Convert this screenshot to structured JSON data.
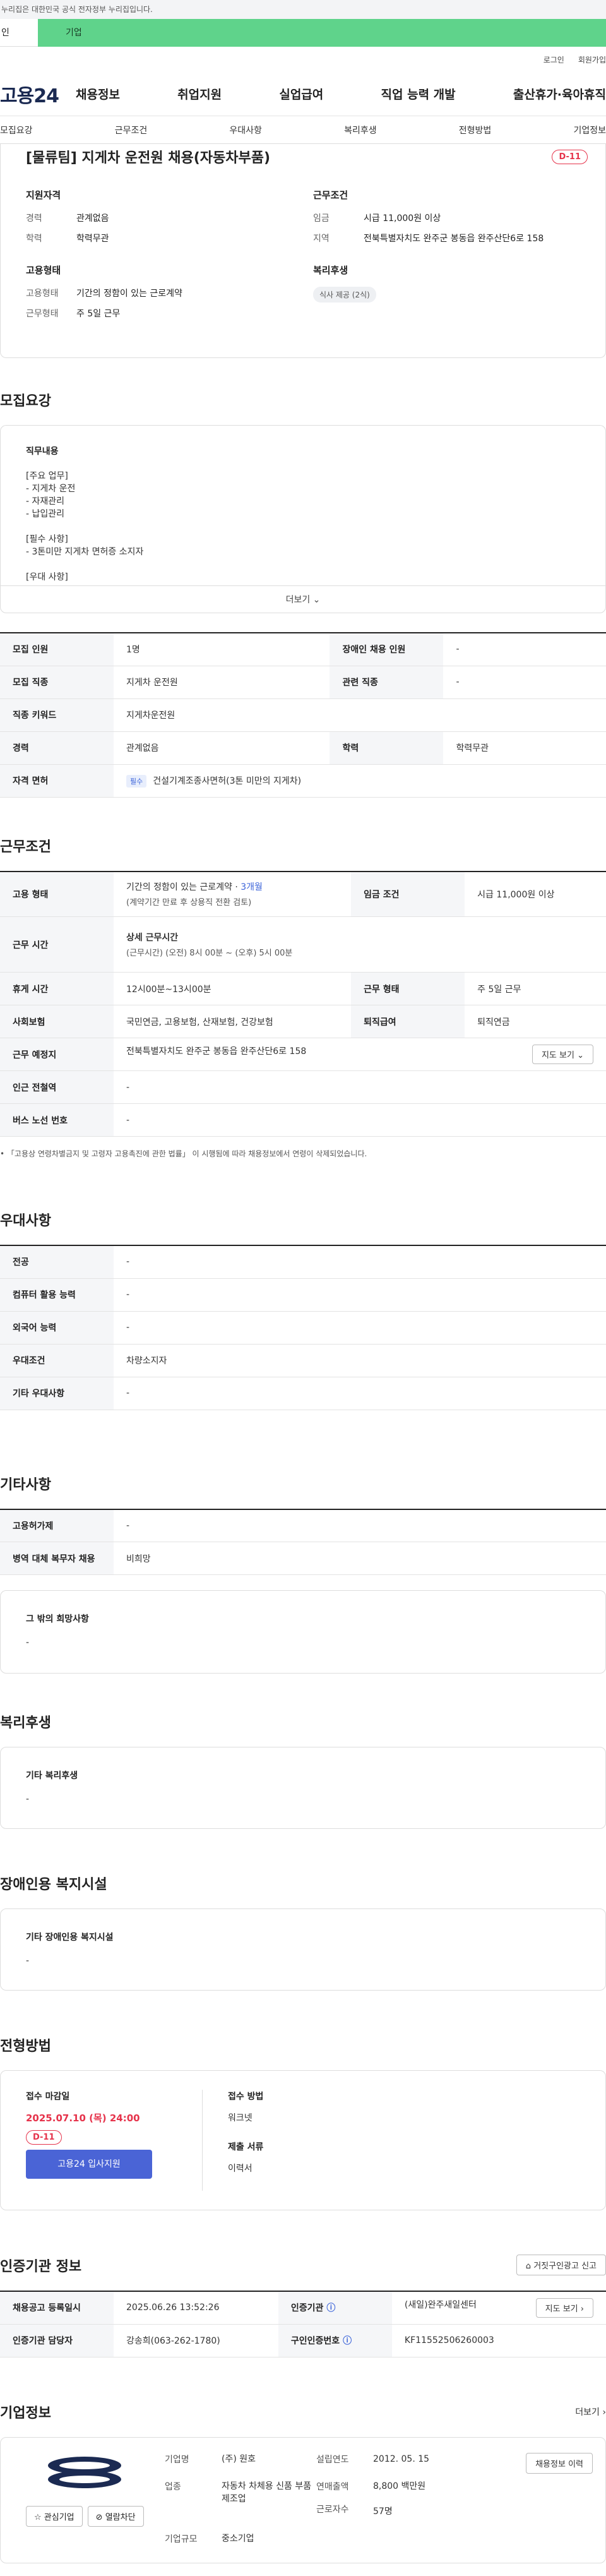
{
  "gov_banner": "누리집은 대한민국 공식 전자정부 누리집입니다.",
  "top_tabs": {
    "individual": "인",
    "company": "기업"
  },
  "util": {
    "login": "로그인",
    "signup": "회원가입"
  },
  "logo": "고용24",
  "gnb": [
    "채용정보",
    "취업지원",
    "실업급여",
    "직업 능력 개발",
    "출산휴가·육아휴직"
  ],
  "anchor_tabs": [
    "모집요강",
    "근무조건",
    "우대사항",
    "복리후생",
    "전형방법",
    "기업정보"
  ],
  "summary": {
    "title": "[물류팀] 지게차 운전원 채용(자동차부품)",
    "dday": "D-11",
    "qual": {
      "heading": "지원자격",
      "career_k": "경력",
      "career_v": "관계없음",
      "edu_k": "학력",
      "edu_v": "학력무관"
    },
    "cond": {
      "heading": "근무조건",
      "wage_k": "임금",
      "wage_v": "시급 11,000원 이상",
      "area_k": "지역",
      "area_v": "전북특별자치도 완주군 봉동읍 완주산단6로 158"
    },
    "emp": {
      "heading": "고용형태",
      "type_k": "고용형태",
      "type_v": "기간의 정함이 있는 근로계약",
      "shape_k": "근무형태",
      "shape_v": "주 5일 근무"
    },
    "welfare": {
      "heading": "복리후생",
      "chip": "식사 제공 (2식)"
    }
  },
  "recruit": {
    "section": "모집요강",
    "duty_heading": "직무내용",
    "lines_a": [
      "[주요 업무]",
      "- 지게차 운전",
      "- 자재관리",
      "- 납입관리"
    ],
    "lines_b": [
      "[필수 사항]",
      "- 3톤미만 지게차 면허증 소지자"
    ],
    "lines_c": [
      "[우대 사항]"
    ],
    "more": "더보기",
    "table": {
      "headcount_k": "모집 인원",
      "headcount_v": "1명",
      "disabled_k": "장애인 채용 인원",
      "disabled_v": "-",
      "job_k": "모집 직종",
      "job_v": "지게차 운전원",
      "related_k": "관련 직종",
      "related_v": "-",
      "keyword_k": "직종 키워드",
      "keyword_v": "지게차운전원",
      "career_k": "경력",
      "career_v": "관계없음",
      "edu_k": "학력",
      "edu_v": "학력무관",
      "license_k": "자격 면허",
      "license_tag": "필수",
      "license_v": "건설기계조종사면허(3톤 미만의 지게차)"
    }
  },
  "work": {
    "section": "근무조건",
    "emp_k": "고용 형태",
    "emp_v": "기간의 정함이 있는 근로계약 · ",
    "emp_v_blue": "3개월",
    "emp_sub": "(계약기간 만료 후 상용직 전환 검토)",
    "wage_k": "임금 조건",
    "wage_v": "시급 11,000원 이상",
    "hours_k": "근무 시간",
    "hours_title": "상세 근무시간",
    "hours_v": "(근무시간) (오전) 8시 00분 ~ (오후) 5시 00분",
    "break_k": "휴게 시간",
    "break_v": "12시00분~13시00분",
    "shape_k": "근무 형태",
    "shape_v": "주 5일 근무",
    "ins_k": "사회보험",
    "ins_v": "국민연금, 고용보험, 산재보험, 건강보험",
    "retire_k": "퇴직급여",
    "retire_v": "퇴직연금",
    "place_k": "근무 예정지",
    "place_v": "전북특별자치도 완주군 봉동읍 완주산단6로 158",
    "map_btn": "지도 보기",
    "station_k": "인근 전철역",
    "station_v": "-",
    "bus_k": "버스 노선 번호",
    "bus_v": "-",
    "note": "「고용상 연령차별금지 및 고령자 고용촉진에 관한 법률」 이 시행됨에 따라 채용정보에서 연령이 삭제되었습니다."
  },
  "pref": {
    "section": "우대사항",
    "major_k": "전공",
    "major_v": "-",
    "pc_k": "컴퓨터 활용 능력",
    "pc_v": "-",
    "lang_k": "외국어 능력",
    "lang_v": "-",
    "cond_k": "우대조건",
    "cond_v": "차량소지자",
    "etc_k": "기타 우대사항",
    "etc_v": "-"
  },
  "etc": {
    "section": "기타사항",
    "hire_k": "고용허가제",
    "hire_v": "-",
    "mil_k": "병역 대체 복무자 채용",
    "mil_v": "비희망",
    "wish_heading": "그 밖의 희망사항",
    "wish_v": "-"
  },
  "welfare": {
    "section": "복리후생",
    "heading": "기타 복리후생",
    "value": "-"
  },
  "disabled_fac": {
    "section": "장애인용 복지시설",
    "heading": "기타 장애인용 복지시설",
    "value": "-"
  },
  "process": {
    "section": "전형방법",
    "deadline_h": "접수 마감일",
    "deadline_v": "2025.07.10 (목) 24:00",
    "dday": "D-11",
    "apply_btn": "고용24 입사지원",
    "method_h": "접수 방법",
    "method_v": "워크넷",
    "docs_h": "제출 서류",
    "docs_v": "이력서"
  },
  "agency": {
    "section": "인증기관 정보",
    "report_btn": "거짓구인광고 신고",
    "reg_k": "채용공고 등록일시",
    "reg_v": "2025.06.26 13:52:26",
    "org_k": "인증기관",
    "org_v": "(새일)완주새일센터",
    "map_btn": "지도 보기",
    "staff_k": "인증기관 담당자",
    "staff_v": "강송희(063-262-1780)",
    "num_k": "구인인증번호",
    "num_v": "KF11552506260003"
  },
  "company": {
    "section": "기업정보",
    "more": "더보기",
    "fav_btn": "관심기업",
    "block_btn": "열람차단",
    "name_k": "기업명",
    "name_v": "(주) 원호",
    "est_k": "설립연도",
    "est_v": "2012. 05. 15",
    "ind_k": "업종",
    "ind_v": "자동차 차체용 신품 부품 제조업",
    "sales_k": "연매출액",
    "sales_v": "8,800 백만원",
    "emp_k": "근로자수",
    "emp_v": "57명",
    "size_k": "기업규모",
    "size_v": "중소기업",
    "view_btn": "채용정보 이력"
  }
}
